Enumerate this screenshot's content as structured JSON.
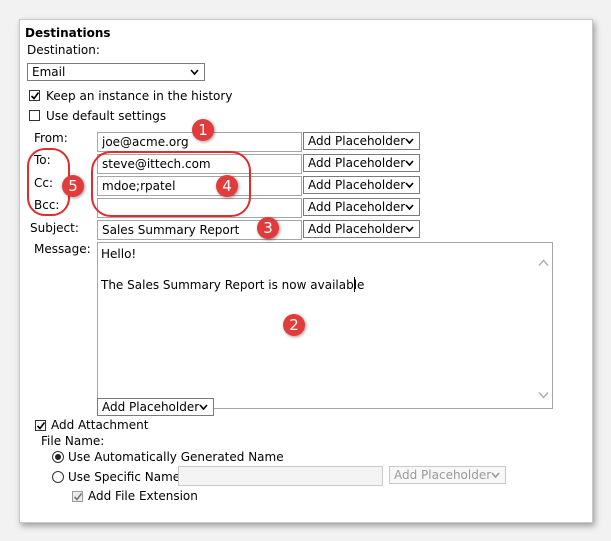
{
  "section": {
    "title": "Destinations"
  },
  "destination": {
    "label": "Destination:",
    "value": "Email"
  },
  "keep_instance": {
    "label": "Keep an instance in the history",
    "checked": true
  },
  "use_default": {
    "label": "Use default settings",
    "checked": false
  },
  "fields": {
    "from": {
      "label": "From:",
      "value": "joe@acme.org",
      "placeholder_select": "Add Placeholder"
    },
    "to": {
      "label": "To:",
      "value": "steve@ittech.com",
      "placeholder_select": "Add Placeholder"
    },
    "cc": {
      "label": "Cc:",
      "value": "mdoe;rpatel",
      "placeholder_select": "Add Placeholder"
    },
    "bcc": {
      "label": "Bcc:",
      "value": "",
      "placeholder_select": "Add Placeholder"
    },
    "subject": {
      "label": "Subject:",
      "value": "Sales Summary Report",
      "placeholder_select": "Add Placeholder"
    }
  },
  "message": {
    "label": "Message:",
    "line1": "Hello!",
    "line2": "The Sales Summary Report is now available",
    "placeholder_select": "Add Placeholder"
  },
  "attachment": {
    "label": "Add Attachment",
    "checked": true,
    "file_name_label": "File Name:",
    "auto_name_label": "Use Automatically Generated Name",
    "specific_name_label": "Use Specific Name",
    "specific_placeholder_select": "Add Placeholder",
    "add_extension_label": "Add File Extension"
  },
  "annotations": {
    "n1": "1",
    "n2": "2",
    "n3": "3",
    "n4": "4",
    "n5": "5"
  },
  "colors": {
    "annotation_red": "#e23b3b",
    "panel_bg": "#ffffff",
    "page_bg": "#f2f2f2"
  },
  "icons": [
    "chevron-down-icon",
    "checkmark-icon",
    "scroll-up-icon",
    "scroll-down-icon"
  ]
}
